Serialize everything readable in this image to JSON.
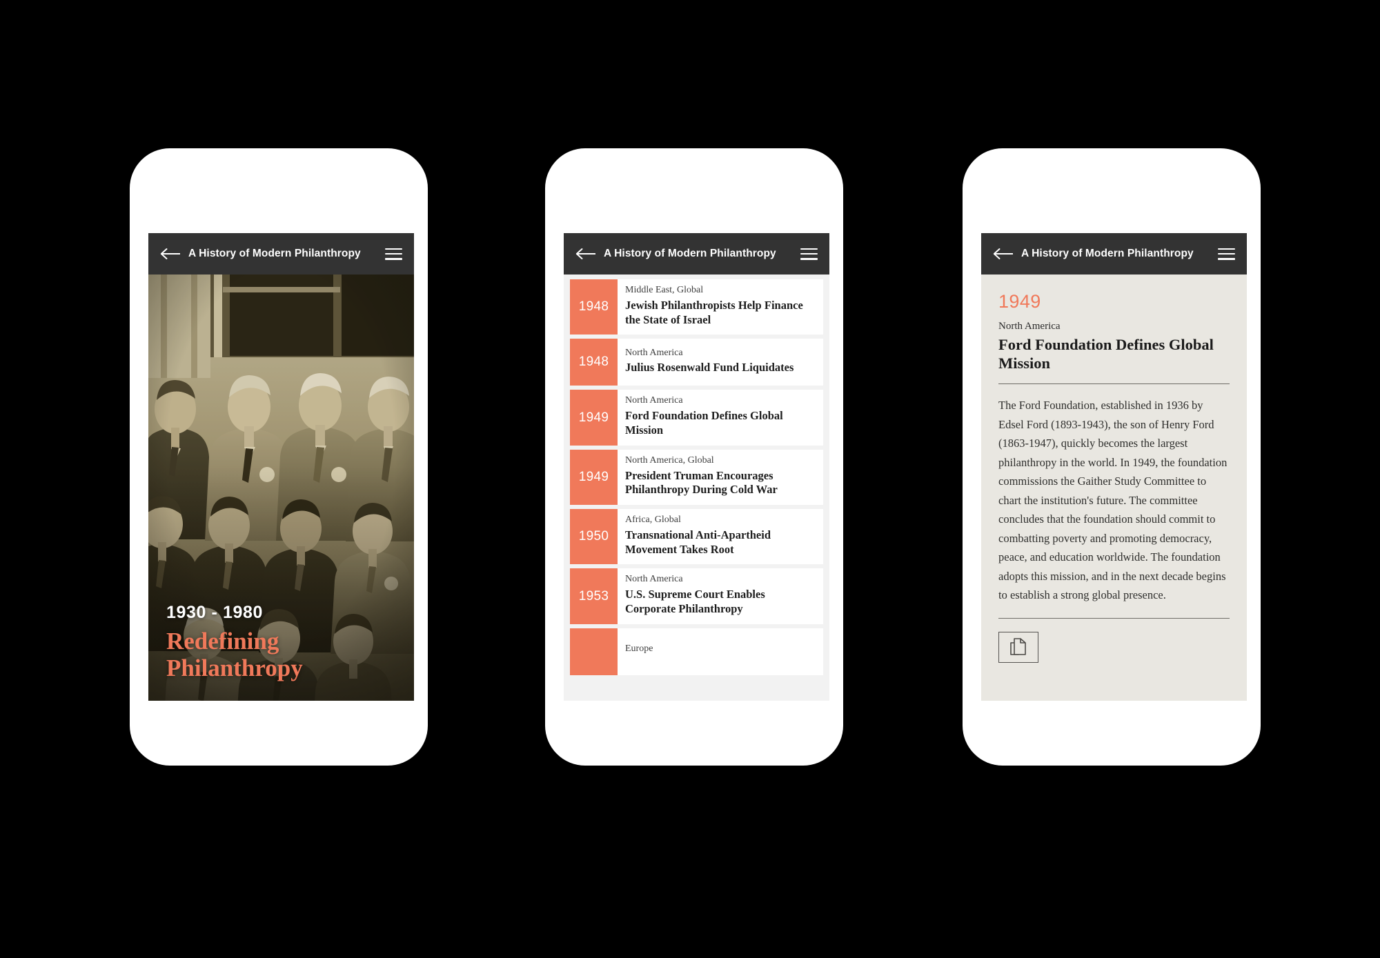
{
  "page": {
    "background_color": "#000000",
    "accent_color": "#f0795a",
    "appbar_color": "#333333",
    "detail_bg_color": "#e9e7e1"
  },
  "appbar": {
    "title": "A History of Modern Philanthropy",
    "back_icon": "back-arrow-icon",
    "menu_icon": "hamburger-menu-icon"
  },
  "screen_cover": {
    "era": "1930 - 1980",
    "title": "Redefining Philanthropy",
    "photo_alt": "Vintage sepia group portrait of men in suits on steps"
  },
  "screen_list": {
    "items": [
      {
        "year": "1948",
        "region": "Middle East, Global",
        "title": "Jewish Philanthropists Help Finance the State of Israel"
      },
      {
        "year": "1948",
        "region": "North America",
        "title": "Julius Rosenwald Fund Liquidates"
      },
      {
        "year": "1949",
        "region": "North America",
        "title": "Ford Foundation Defines Global Mission"
      },
      {
        "year": "1949",
        "region": "North America, Global",
        "title": "President Truman Encourages Philanthropy During Cold War"
      },
      {
        "year": "1950",
        "region": "Africa, Global",
        "title": "Transnational Anti-Apartheid Movement Takes Root"
      },
      {
        "year": "1953",
        "region": "North America",
        "title": "U.S. Supreme Court Enables Corporate Philanthropy"
      },
      {
        "year": "",
        "region": "Europe",
        "title": ""
      }
    ]
  },
  "screen_detail": {
    "year": "1949",
    "region": "North America",
    "title": "Ford Foundation Defines Global Mission",
    "body": "The Ford Foundation, established in 1936 by Edsel Ford (1893-1943), the son of Henry Ford (1863-1947), quickly becomes the largest philanthropy in the world. In 1949, the foundation commissions the Gaither Study Committee to chart the institution's future. The committee concludes that the foundation should commit to combatting poverty and promoting democracy, peace, and education worldwide. The foundation adopts this mission, and in the next decade begins to establish a strong global presence.",
    "doc_button_icon": "documents-copy-icon"
  }
}
